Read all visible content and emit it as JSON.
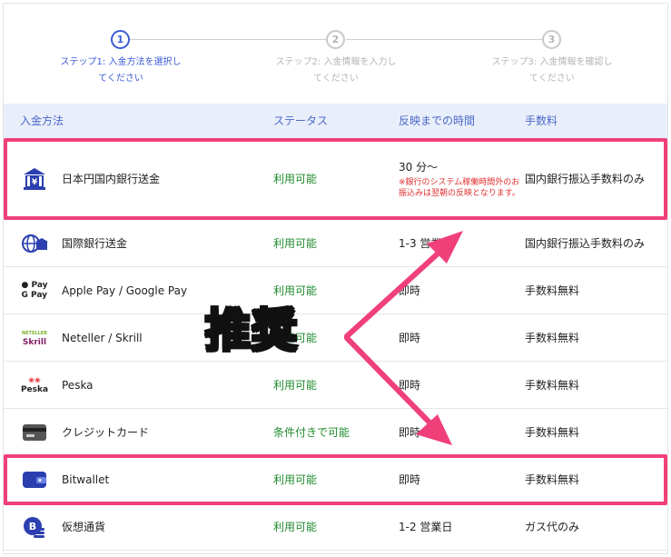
{
  "steps": [
    {
      "num": "1",
      "label_line1": "ステップ1: 入金方法を選択し",
      "label_line2": "てください",
      "active": true
    },
    {
      "num": "2",
      "label_line1": "ステップ2: 入金情報を入力し",
      "label_line2": "てください",
      "active": false
    },
    {
      "num": "3",
      "label_line1": "ステップ3: 入金情報を確認し",
      "label_line2": "てください",
      "active": false
    }
  ],
  "table": {
    "headers": {
      "method": "入金方法",
      "status": "ステータス",
      "time": "反映までの時間",
      "fee": "手数料"
    },
    "rows": [
      {
        "icon": "bank-yen-icon",
        "name": "日本円国内銀行送金",
        "status": "利用可能",
        "time": "30 分〜",
        "note": "※銀行のシステム稼働時間外のお振込みは翌朝の反映となります。",
        "fee": "国内銀行振込手数料のみ"
      },
      {
        "icon": "globe-bank-icon",
        "name": "国際銀行送金",
        "status": "利用可能",
        "time": "1-3 営業日",
        "fee": "国内銀行振込手数料のみ"
      },
      {
        "icon": "apple-google-pay-icon",
        "name": "Apple Pay / Google Pay",
        "status": "利用可能",
        "time": "即時",
        "fee": "手数料無料"
      },
      {
        "icon": "neteller-skrill-icon",
        "name": "Neteller / Skrill",
        "status": "利用可能",
        "time": "即時",
        "fee": "手数料無料"
      },
      {
        "icon": "peska-icon",
        "name": "Peska",
        "status": "利用可能",
        "time": "即時",
        "fee": "手数料無料"
      },
      {
        "icon": "credit-card-icon",
        "name": "クレジットカード",
        "status": "条件付きで可能",
        "time": "即時",
        "fee": "手数料無料"
      },
      {
        "icon": "wallet-icon",
        "name": "Bitwallet",
        "status": "利用可能",
        "time": "即時",
        "fee": "手数料無料"
      },
      {
        "icon": "crypto-coin-icon",
        "name": "仮想通貨",
        "status": "利用可能",
        "time": "1-2 営業日",
        "fee": "ガス代のみ"
      }
    ]
  },
  "icon_logos": {
    "apple_pay": "Pay",
    "google_pay": "G Pay",
    "neteller": "NETELLER",
    "skrill": "Skrill",
    "peska": "Peska",
    "crypto": "B"
  },
  "annotation": {
    "text": "推奨",
    "color": "#f5ee1a"
  },
  "colors": {
    "accent": "#3b5bd6",
    "status_green": "#1f8a2e",
    "note_red": "#e0302f",
    "highlight": "#f0407a",
    "header_bg": "#e9eefb"
  }
}
